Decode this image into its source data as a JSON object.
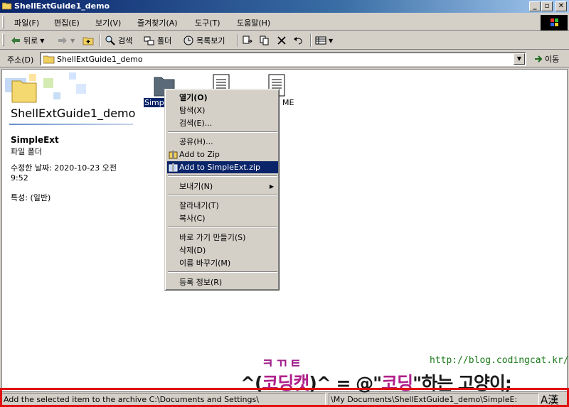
{
  "window": {
    "title": "ShellExtGuide1_demo"
  },
  "menubar": {
    "items": [
      "파일(F)",
      "편집(E)",
      "보기(V)",
      "즐겨찾기(A)",
      "도구(T)",
      "도움말(H)"
    ]
  },
  "toolbar": {
    "back": "뒤로",
    "search": "검색",
    "folders": "폴더",
    "views": "목록보기"
  },
  "address": {
    "label": "주소(D)",
    "value": "ShellExtGuide1_demo",
    "go": "이동"
  },
  "folder_panel": {
    "title": "ShellExtGuide1_demo",
    "selected_name": "SimpleExt",
    "selected_type": "파일 폴더",
    "modified": "수정한 날짜: 2020-10-23 오전 9:52",
    "attributes": "특성: (일반)"
  },
  "files": [
    {
      "label": "Simp",
      "selected": true
    },
    {
      "label": "",
      "selected": false
    },
    {
      "label": "ME",
      "selected": false
    }
  ],
  "context_menu": {
    "items": [
      {
        "label": "열기(O)",
        "bold": true
      },
      {
        "label": "탐색(X)"
      },
      {
        "label": "검색(E)..."
      },
      {
        "label": "공유(H)..."
      },
      {
        "label": "Add to Zip",
        "icon": "zip-icon"
      },
      {
        "label": "Add to SimpleExt.zip",
        "icon": "zip-icon",
        "highlighted": true
      },
      {
        "label": "보내기(N)",
        "submenu": true
      },
      {
        "label": "잘라내기(T)"
      },
      {
        "label": "복사(C)"
      },
      {
        "label": "바로 가기 만들기(S)"
      },
      {
        "label": "삭제(D)"
      },
      {
        "label": "이름 바꾸기(M)"
      },
      {
        "label": "등록 정보(R)"
      }
    ]
  },
  "status": {
    "left": "Add the selected item to the archive C:\\Documents and Settings\\",
    "right": "\\My Documents\\ShellExtGuide1_demo\\SimpleE:",
    "ime": "A漢"
  },
  "watermark": {
    "url": "http://blog.codingcat.kr/",
    "small": "ㅋㄲㅌ",
    "line_a": "^(",
    "line_b": "코딩캣",
    "line_c": ")^ = @\"",
    "line_d": "코딩",
    "line_e": "\"하는 고양이;"
  },
  "colors": {
    "selection": "#0a246a",
    "title_start": "#0a246a",
    "frame_red": "#e01010",
    "url_green": "#1a7a1a"
  }
}
